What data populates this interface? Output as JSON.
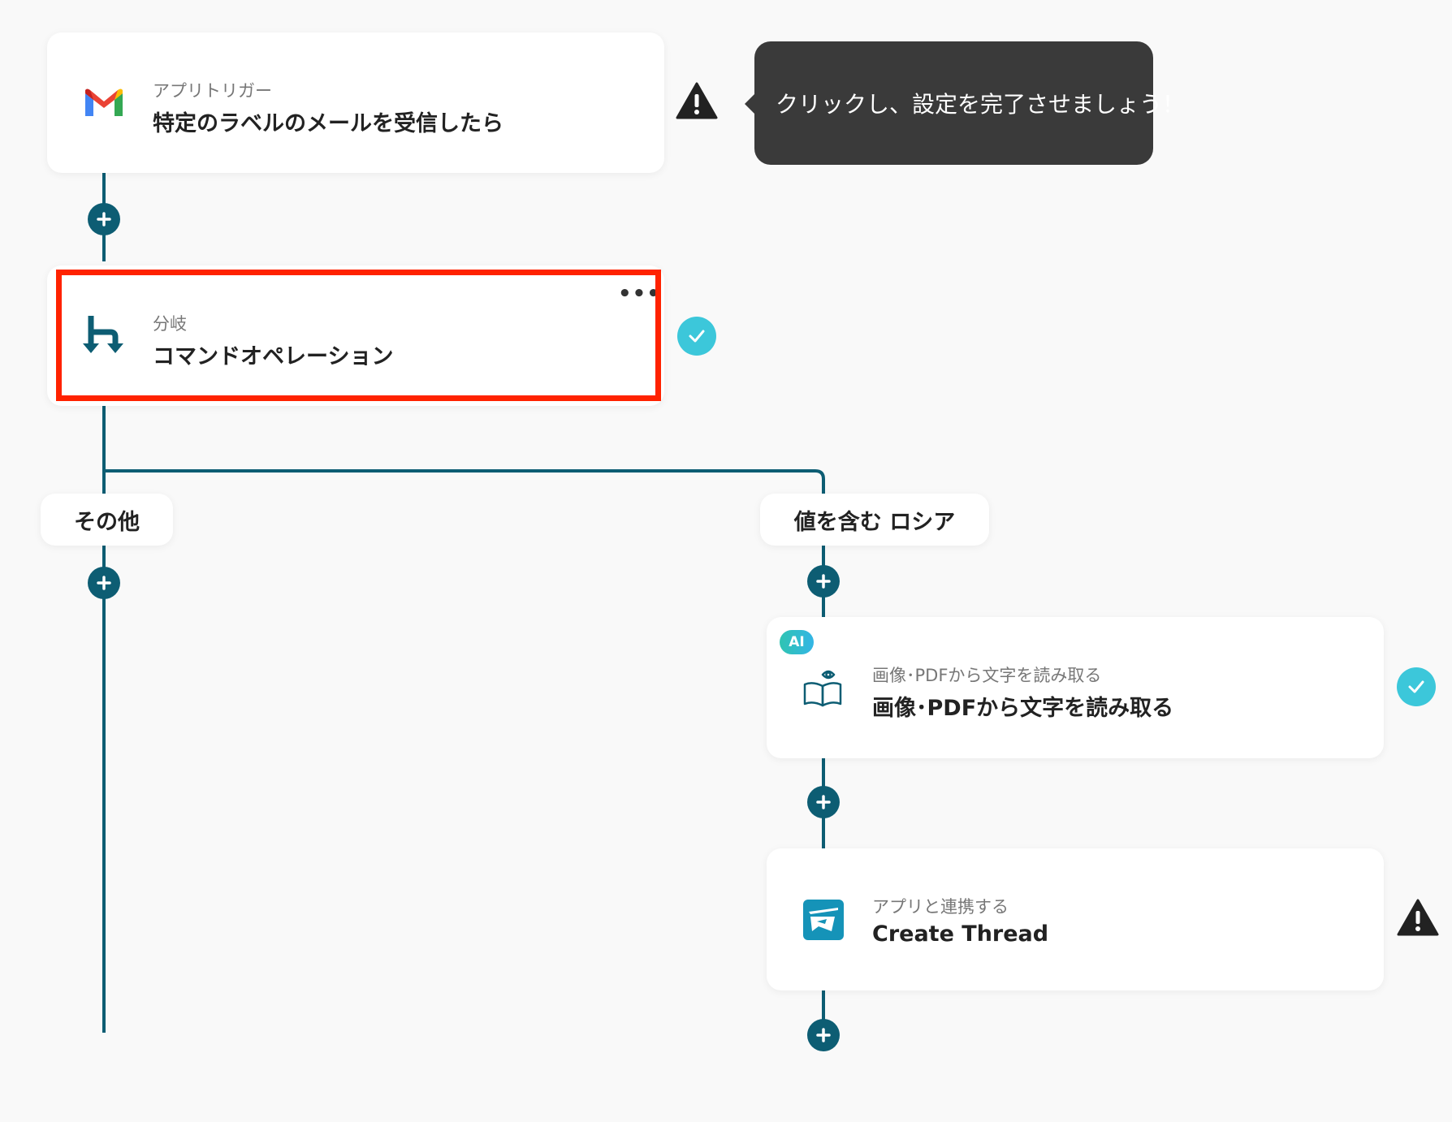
{
  "trigger": {
    "sublabel": "アプリトリガー",
    "title": "特定のラベルのメールを受信したら",
    "icon": "gmail-icon",
    "status": "warning"
  },
  "tooltip": {
    "text": "クリックし、設定を完了させましょう！"
  },
  "branch": {
    "sublabel": "分岐",
    "title": "コマンドオペレーション",
    "icon": "branch-icon",
    "status": "complete",
    "menu": "•••"
  },
  "branches": {
    "left_label": "その他",
    "right_label": "値を含む ロシア"
  },
  "ocr": {
    "badge": "AI",
    "sublabel": "画像･PDFから文字を読み取る",
    "title": "画像･PDFから文字を読み取る",
    "icon": "book-eye-icon",
    "status": "complete"
  },
  "thread": {
    "sublabel": "アプリと連携する",
    "title": "Create Thread",
    "icon": "chatwork-app-icon",
    "status": "warning"
  },
  "colors": {
    "line": "#0d5d73",
    "plus_bg": "#0d5d73",
    "check_bg": "#3cc7da",
    "highlight": "#ff2200",
    "tooltip_bg": "#3a3a3a"
  }
}
